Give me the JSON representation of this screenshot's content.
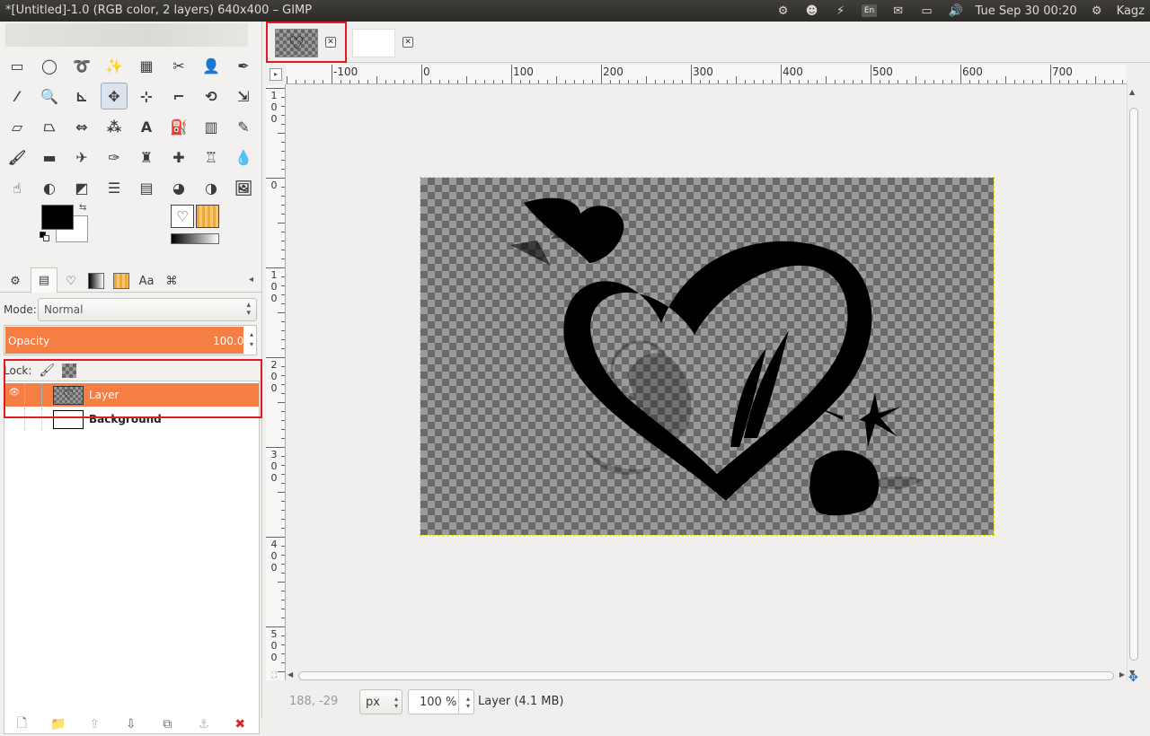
{
  "window": {
    "title": "*[Untitled]-1.0 (RGB color, 2 layers) 640x400 – GIMP"
  },
  "tray": {
    "keyboard": "En",
    "datetime": "Tue Sep 30 00:20",
    "user": "Kagz"
  },
  "tools": [
    {
      "name": "rect-select-tool",
      "icon": "rect-select-icon",
      "glyph": "▭"
    },
    {
      "name": "ellipse-select-tool",
      "icon": "ellipse-select-icon",
      "glyph": "◯"
    },
    {
      "name": "free-select-tool",
      "icon": "lasso-icon",
      "glyph": "➰"
    },
    {
      "name": "fuzzy-select-tool",
      "icon": "magic-wand-icon",
      "glyph": "✨"
    },
    {
      "name": "color-select-tool",
      "icon": "color-select-icon",
      "glyph": "▦"
    },
    {
      "name": "scissors-tool",
      "icon": "scissors-icon",
      "glyph": "✂"
    },
    {
      "name": "foreground-select-tool",
      "icon": "foreground-select-icon",
      "glyph": "👤"
    },
    {
      "name": "paths-tool",
      "icon": "paths-icon",
      "glyph": "✒"
    },
    {
      "name": "color-picker-tool",
      "icon": "eyedropper-icon",
      "glyph": "⁄"
    },
    {
      "name": "zoom-tool",
      "icon": "magnifier-icon",
      "glyph": "🔍"
    },
    {
      "name": "measure-tool",
      "icon": "compass-icon",
      "glyph": "⊾"
    },
    {
      "name": "move-tool",
      "icon": "move-icon",
      "glyph": "✥"
    },
    {
      "name": "align-tool",
      "icon": "align-icon",
      "glyph": "⊹"
    },
    {
      "name": "crop-tool",
      "icon": "crop-icon",
      "glyph": "⌐"
    },
    {
      "name": "rotate-tool",
      "icon": "rotate-icon",
      "glyph": "⟲"
    },
    {
      "name": "scale-tool",
      "icon": "scale-icon",
      "glyph": "⇲"
    },
    {
      "name": "shear-tool",
      "icon": "shear-icon",
      "glyph": "▱"
    },
    {
      "name": "perspective-tool",
      "icon": "perspective-icon",
      "glyph": "⏢"
    },
    {
      "name": "flip-tool",
      "icon": "flip-icon",
      "glyph": "⇔"
    },
    {
      "name": "cage-tool",
      "icon": "cage-icon",
      "glyph": "⁂"
    },
    {
      "name": "text-tool",
      "icon": "text-icon",
      "glyph": "A"
    },
    {
      "name": "bucket-fill-tool",
      "icon": "bucket-icon",
      "glyph": "⛽"
    },
    {
      "name": "blend-tool",
      "icon": "gradient-icon",
      "glyph": "▥"
    },
    {
      "name": "pencil-tool",
      "icon": "pencil-icon",
      "glyph": "✎"
    },
    {
      "name": "paintbrush-tool",
      "icon": "paintbrush-icon",
      "glyph": "🖌"
    },
    {
      "name": "eraser-tool",
      "icon": "eraser-icon",
      "glyph": "▬"
    },
    {
      "name": "airbrush-tool",
      "icon": "airbrush-icon",
      "glyph": "✈"
    },
    {
      "name": "ink-tool",
      "icon": "ink-icon",
      "glyph": "✑"
    },
    {
      "name": "clone-tool",
      "icon": "stamp-icon",
      "glyph": "♜"
    },
    {
      "name": "heal-tool",
      "icon": "heal-icon",
      "glyph": "✚"
    },
    {
      "name": "perspective-clone-tool",
      "icon": "perspective-clone-icon",
      "glyph": "♖"
    },
    {
      "name": "blur-tool",
      "icon": "blur-drop-icon",
      "glyph": "💧"
    },
    {
      "name": "smudge-tool",
      "icon": "smudge-icon",
      "glyph": "☝"
    },
    {
      "name": "dodge-burn-tool",
      "icon": "dodge-burn-icon",
      "glyph": "◐"
    },
    {
      "name": "color-balance-tool",
      "icon": "color-balance-icon",
      "glyph": "◩"
    },
    {
      "name": "levels-tool",
      "icon": "levels-icon",
      "glyph": "☰"
    },
    {
      "name": "hue-tool",
      "icon": "hue-icon",
      "glyph": "▤"
    },
    {
      "name": "colorize-tool",
      "icon": "colorize-icon",
      "glyph": "◕"
    },
    {
      "name": "threshold-tool",
      "icon": "threshold-icon",
      "glyph": "◑"
    },
    {
      "name": "curves-tool",
      "icon": "curves-icon",
      "glyph": "🖼"
    }
  ],
  "dock_tabs": [
    {
      "name": "tab-tool-options",
      "glyph": "⚙"
    },
    {
      "name": "tab-layers",
      "glyph": "▤"
    },
    {
      "name": "tab-brushes",
      "glyph": "♡"
    },
    {
      "name": "tab-gradients",
      "glyph": ""
    },
    {
      "name": "tab-patterns",
      "glyph": ""
    },
    {
      "name": "tab-fonts",
      "glyph": "Aa"
    },
    {
      "name": "tab-paths",
      "glyph": "⌘"
    }
  ],
  "layers_panel": {
    "mode_label": "Mode:",
    "mode_value": "Normal",
    "opacity_label": "Opacity",
    "opacity_value": "100.0",
    "lock_label": "Lock:",
    "layers": [
      {
        "name": "Layer",
        "selected": true
      },
      {
        "name": "Background",
        "selected": false
      }
    ]
  },
  "image_tabs": [
    {
      "thumb": "♡"
    },
    {
      "thumb": ""
    }
  ],
  "status": {
    "coords": "188, -29",
    "unit": "px",
    "zoom": "100 %",
    "layer_info": "Layer (4.1 MB)"
  },
  "ruler": {
    "h_labels": [
      "-100",
      "0",
      "100",
      "200",
      "300",
      "400",
      "500",
      "600",
      "700"
    ],
    "v_labels": [
      "100",
      "0",
      "100",
      "200",
      "300",
      "400",
      "500"
    ]
  },
  "colors": {
    "accent": "#f47e43",
    "highlight_box": "#e01b24"
  }
}
